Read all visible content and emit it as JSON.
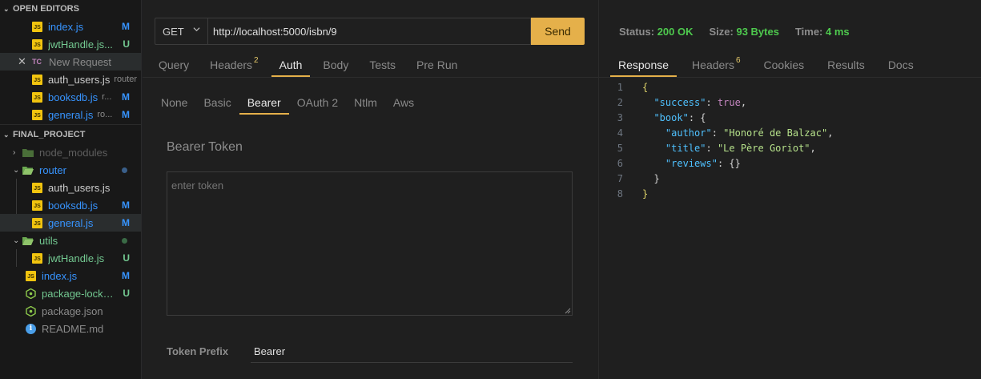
{
  "explorer": {
    "open_editors_header": "OPEN EDITORS",
    "open_editors": [
      {
        "name": "index.js",
        "desc": "",
        "badge": "M"
      },
      {
        "name": "jwtHandle.js...",
        "desc": "",
        "badge": "U"
      },
      {
        "name": "New Request",
        "desc": "",
        "badge": ""
      },
      {
        "name": "auth_users.js",
        "desc": "router",
        "badge": ""
      },
      {
        "name": "booksdb.js",
        "desc": "r...",
        "badge": "M"
      },
      {
        "name": "general.js",
        "desc": "ro...",
        "badge": "M"
      }
    ],
    "project_header": "FINAL_PROJECT",
    "tree": {
      "node_modules": "node_modules",
      "router": "router",
      "router_files": [
        {
          "name": "auth_users.js",
          "badge": ""
        },
        {
          "name": "booksdb.js",
          "badge": "M"
        },
        {
          "name": "general.js",
          "badge": "M"
        }
      ],
      "utils": "utils",
      "utils_files": [
        {
          "name": "jwtHandle.js",
          "badge": "U"
        }
      ],
      "root_files": [
        {
          "name": "index.js",
          "badge": "M"
        },
        {
          "name": "package-lock.j...",
          "badge": "U"
        },
        {
          "name": "package.json",
          "badge": ""
        },
        {
          "name": "README.md",
          "badge": ""
        }
      ]
    }
  },
  "request": {
    "method": "GET",
    "url": "http://localhost:5000/isbn/9",
    "send_label": "Send",
    "tabs": [
      "Query",
      "Headers",
      "Auth",
      "Body",
      "Tests",
      "Pre Run"
    ],
    "headers_count": "2",
    "active_tab": "Auth",
    "auth_tabs": [
      "None",
      "Basic",
      "Bearer",
      "OAuth 2",
      "Ntlm",
      "Aws"
    ],
    "active_auth_tab": "Bearer",
    "bearer_title": "Bearer Token",
    "token_placeholder": "enter token",
    "token_prefix_label": "Token Prefix",
    "token_prefix_value": "Bearer"
  },
  "response": {
    "status_label": "Status:",
    "status_value": "200 OK",
    "size_label": "Size:",
    "size_value": "93 Bytes",
    "time_label": "Time:",
    "time_value": "4 ms",
    "tabs": [
      "Response",
      "Headers",
      "Cookies",
      "Results",
      "Docs"
    ],
    "headers_count": "6",
    "active_tab": "Response",
    "line_numbers": [
      "1",
      "2",
      "3",
      "4",
      "5",
      "6",
      "7",
      "8"
    ],
    "json": {
      "success_key": "\"success\"",
      "success_val": "true",
      "book_key": "\"book\"",
      "author_key": "\"author\"",
      "author_val": "\"Honoré de Balzac\"",
      "title_key": "\"title\"",
      "title_val": "\"Le Père Goriot\"",
      "reviews_key": "\"reviews\"",
      "reviews_val": "{}"
    }
  },
  "colors": {
    "accent": "#e5b04a",
    "status_ok": "#4ec94e",
    "modified": "#3794ff",
    "untracked": "#73c991"
  }
}
